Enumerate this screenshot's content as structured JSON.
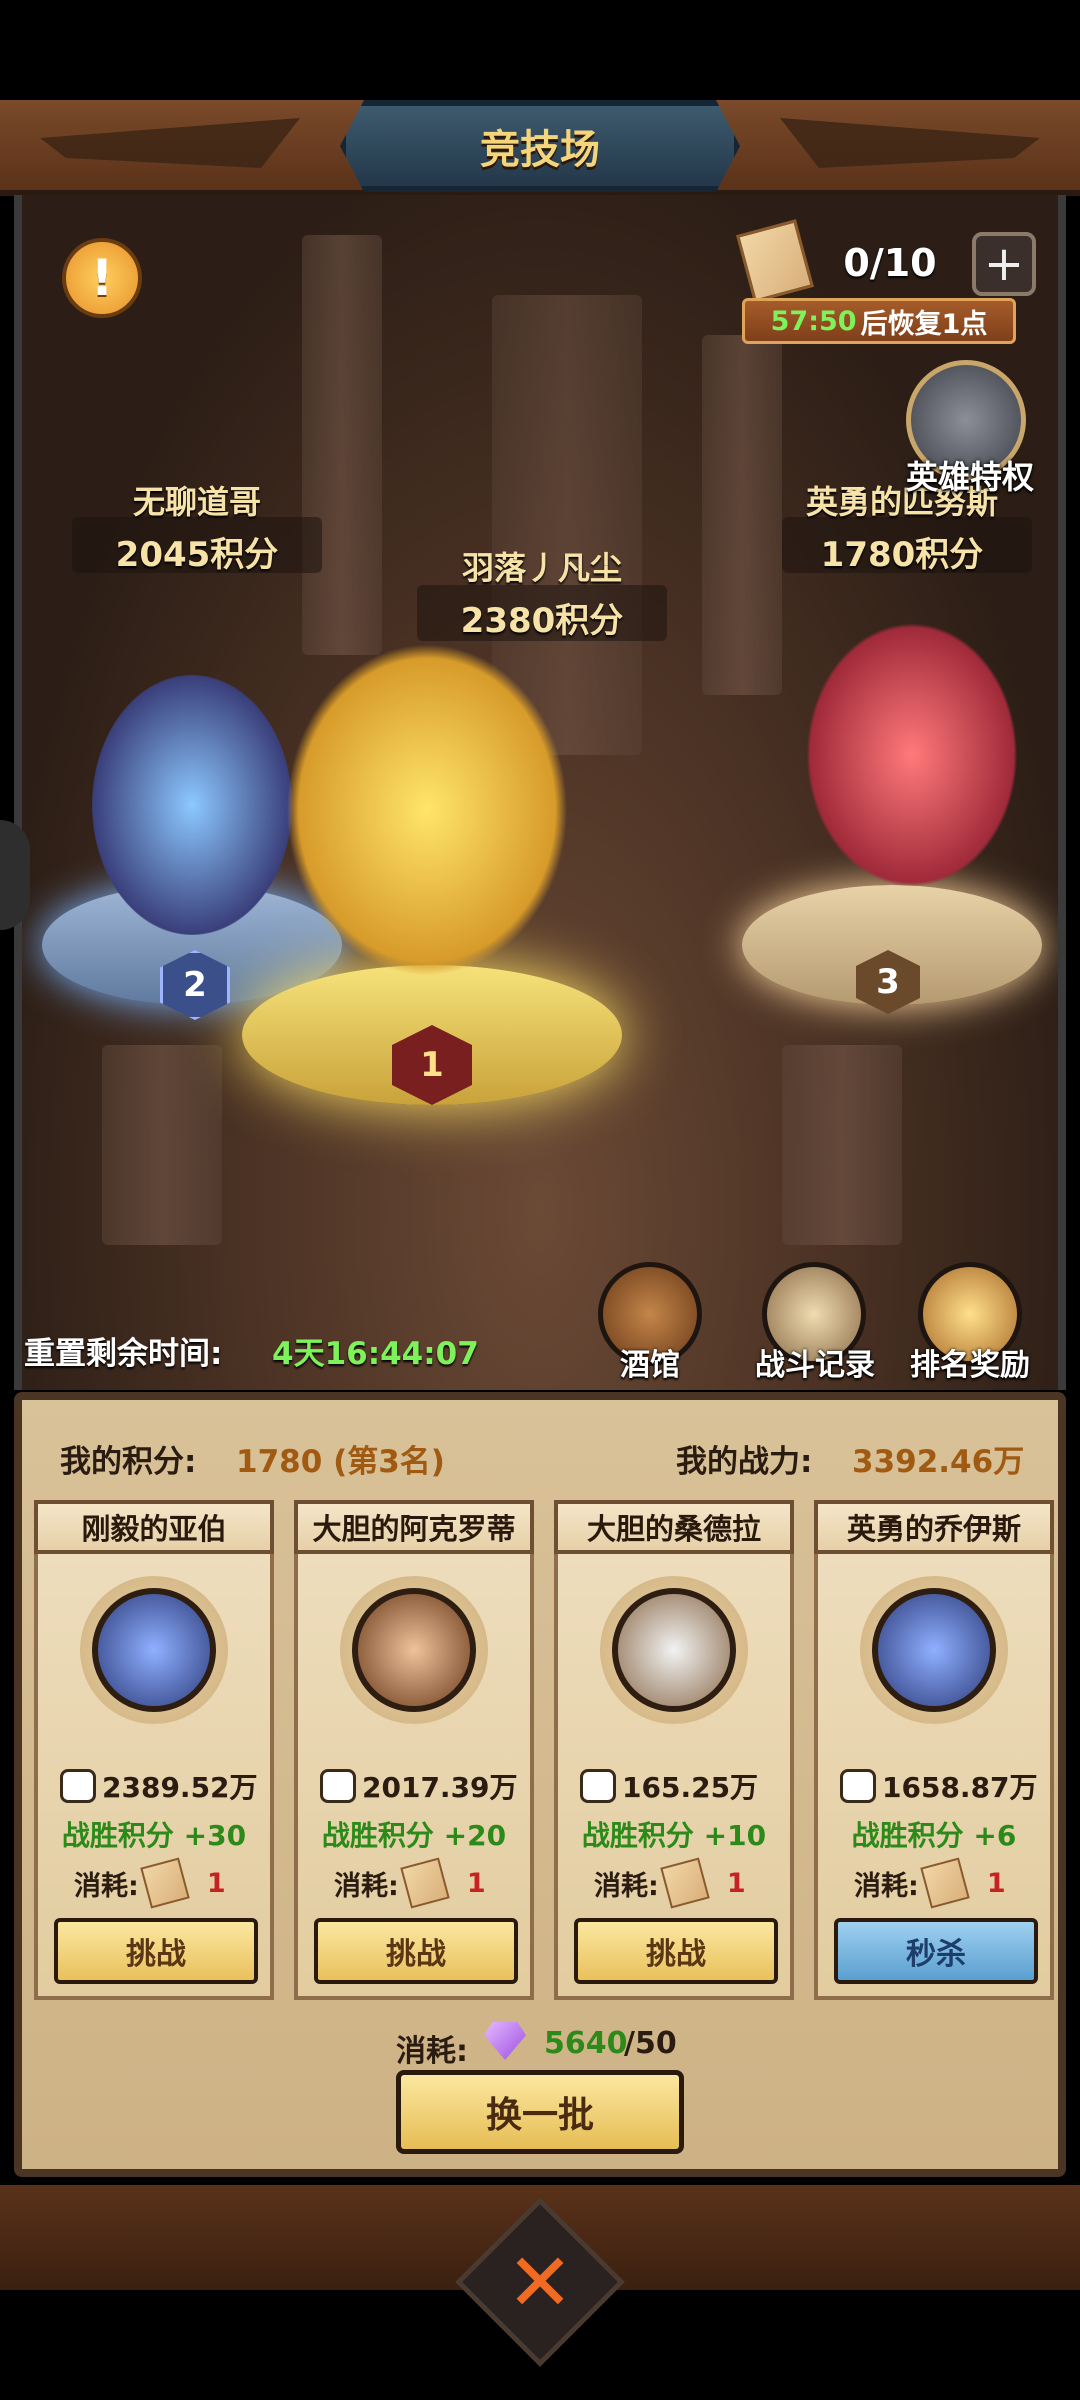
{
  "header": {
    "title": "竞技场"
  },
  "tickets": {
    "count": "0/10",
    "recover_time": "57:50",
    "recover_text": "后恢复1点"
  },
  "privilege": {
    "label": "英雄特权"
  },
  "podium": [
    {
      "rank": "2",
      "name": "无聊道哥",
      "score": "2045积分"
    },
    {
      "rank": "1",
      "name": "羽落丿凡尘",
      "score": "2380积分"
    },
    {
      "rank": "3",
      "name": "英勇的匹努斯",
      "score": "1780积分"
    }
  ],
  "reset": {
    "label": "重置剩余时间:",
    "time": "4天16:44:07"
  },
  "menu": {
    "tavern": "酒馆",
    "battle_log": "战斗记录",
    "rank_reward": "排名奖励"
  },
  "me": {
    "score_label": "我的积分:",
    "score_value": "1780 (第3名)",
    "power_label": "我的战力:",
    "power_value": "3392.46万"
  },
  "opponents": [
    {
      "name": "刚毅的亚伯",
      "power": "2389.52万",
      "win": "战胜积分 +30",
      "cost_label": "消耗:",
      "cost": "1",
      "button": "挑战"
    },
    {
      "name": "大胆的阿克罗蒂",
      "power": "2017.39万",
      "win": "战胜积分 +20",
      "cost_label": "消耗:",
      "cost": "1",
      "button": "挑战"
    },
    {
      "name": "大胆的桑德拉",
      "power": "165.25万",
      "win": "战胜积分 +10",
      "cost_label": "消耗:",
      "cost": "1",
      "button": "挑战"
    },
    {
      "name": "英勇的乔伊斯",
      "power": "1658.87万",
      "win": "战胜积分 +6",
      "cost_label": "消耗:",
      "cost": "1",
      "button": "秒杀"
    }
  ],
  "refresh": {
    "cost_label": "消耗:",
    "diamonds": "5640",
    "max": "/50",
    "button": "换一批"
  },
  "colors": {
    "accent_green": "#7df25a",
    "win_green": "#2b8a18",
    "cost_red": "#c52323",
    "gold": "#f4d57a"
  }
}
